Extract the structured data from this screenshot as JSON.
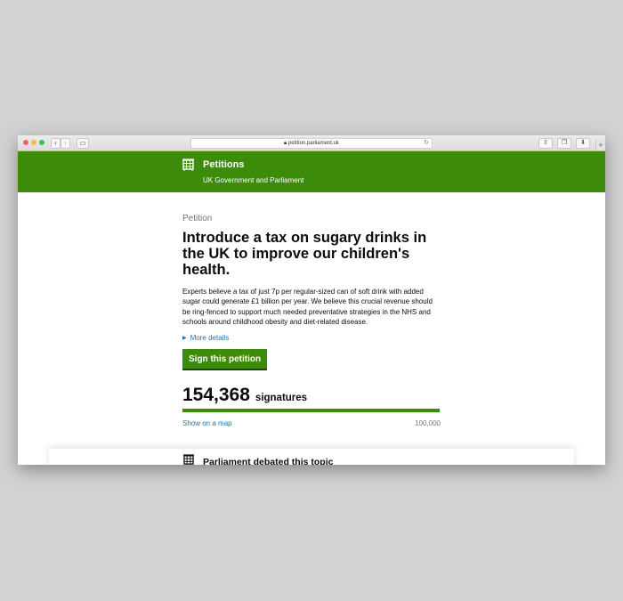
{
  "browser": {
    "url": "petition.parliament.uk",
    "back_icon": "chevron-left-icon",
    "forward_icon": "chevron-right-icon"
  },
  "header": {
    "site_title": "Petitions",
    "site_subtitle": "UK Government and Parliament",
    "brand_color": "#3d8b0b"
  },
  "petition": {
    "kicker": "Petition",
    "title": "Introduce a tax on sugary drinks in the UK to improve our children's health.",
    "summary": "Experts believe a tax of just 7p per regular-sized can of soft drink with added sugar could generate £1 billion per year. We believe this crucial revenue should be ring-fenced to support much needed preventative strategies in the NHS and schools around childhood obesity and diet-related disease.",
    "more_details": "More details",
    "sign_button": "Sign this petition",
    "signature_count": "154,368",
    "signature_label": "signatures",
    "signatures": 154368,
    "target": 100000,
    "target_label": "100,000",
    "progress_fraction": 1.0,
    "map_link": "Show on a map"
  },
  "debate": {
    "title": "Parliament debated this topic"
  }
}
